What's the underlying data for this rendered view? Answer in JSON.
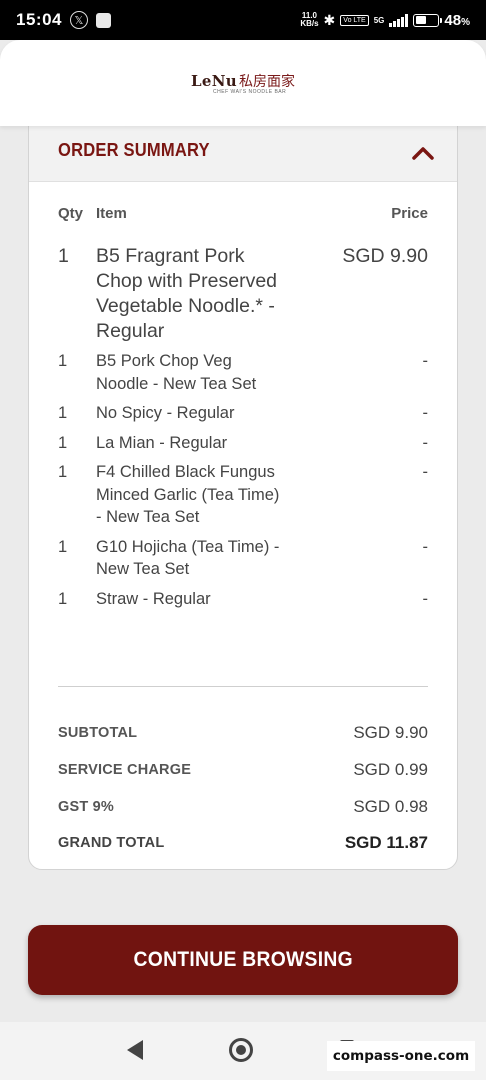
{
  "status_bar": {
    "time": "15:04",
    "net_speed_value": "11.0",
    "net_speed_unit": "KB/s",
    "volte": "Vo LTE",
    "network": "5G",
    "battery_pct": "48",
    "battery_symbol": "%",
    "battery_level": 0.48
  },
  "header": {
    "brand": "LeNu",
    "brand_cn": "私房面家",
    "brand_sub": "CHEF WAI'S NOODLE BAR"
  },
  "order_summary": {
    "title": "ORDER SUMMARY",
    "columns": {
      "qty": "Qty",
      "item": "Item",
      "price": "Price"
    },
    "items": [
      {
        "qty": "1",
        "name": "B5 Fragrant Pork Chop with Preserved Vegetable Noodle.* - Regular",
        "price": "SGD 9.90"
      },
      {
        "qty": "1",
        "name": "B5 Pork Chop Veg Noodle - New Tea Set",
        "price": "-"
      },
      {
        "qty": "1",
        "name": "No Spicy - Regular",
        "price": "-"
      },
      {
        "qty": "1",
        "name": "La Mian - Regular",
        "price": "-"
      },
      {
        "qty": "1",
        "name": "F4 Chilled Black Fungus Minced Garlic (Tea Time) - New Tea Set",
        "price": "-"
      },
      {
        "qty": "1",
        "name": "G10 Hojicha (Tea Time) - New Tea Set",
        "price": "-"
      },
      {
        "qty": "1",
        "name": "Straw - Regular",
        "price": "-"
      }
    ],
    "totals": {
      "subtotal_label": "SUBTOTAL",
      "subtotal": "SGD 9.90",
      "service_label": "SERVICE CHARGE",
      "service": "SGD 0.99",
      "gst_label": "GST 9%",
      "gst": "SGD 0.98",
      "grand_label": "GRAND TOTAL",
      "grand": "SGD 11.87"
    }
  },
  "continue_button": "CONTINUE BROWSING",
  "watermark": "compass-one.com",
  "colors": {
    "accent": "#711410",
    "title": "#7a1612"
  }
}
